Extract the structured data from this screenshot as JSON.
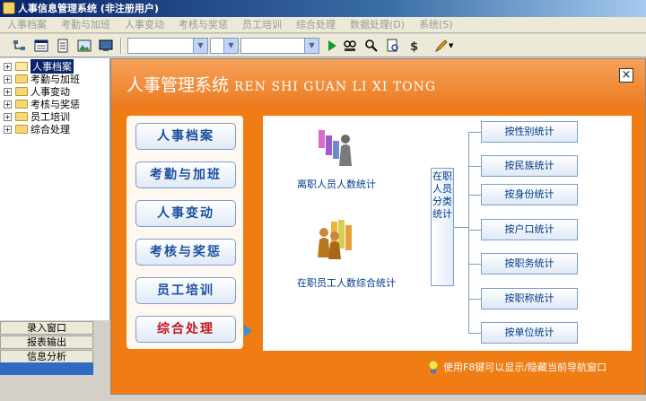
{
  "window": {
    "title": "人事信息管理系统 (非注册用户)"
  },
  "menu": [
    "人事档案",
    "考勤与加班",
    "人事变动",
    "考核与奖惩",
    "员工培训",
    "综合处理",
    "数据处理(D)",
    "系统(S)"
  ],
  "toolbar": {
    "icons": [
      "tree-view-icon",
      "form-icon",
      "document-icon",
      "picture-icon",
      "monitor-icon",
      "run-icon",
      "find-icon",
      "find-next-icon",
      "preview-icon",
      "dollar-icon",
      "pencil-icon"
    ]
  },
  "tree": {
    "items": [
      {
        "label": "人事档案",
        "expander": "+",
        "selected": true,
        "open": true
      },
      {
        "label": "考勤与加班",
        "expander": "+",
        "selected": false
      },
      {
        "label": "人事变动",
        "expander": "+",
        "selected": false
      },
      {
        "label": "考核与奖惩",
        "expander": "+",
        "selected": false
      },
      {
        "label": "员工培训",
        "expander": "+",
        "selected": false
      },
      {
        "label": "综合处理",
        "expander": "+",
        "selected": false
      }
    ]
  },
  "leftnav": {
    "items": [
      "录入窗口",
      "报表输出",
      "信息分析"
    ]
  },
  "main": {
    "title": "人事管理系统",
    "subtitle": "REN SHI GUAN LI XI TONG",
    "close": "×",
    "modules": [
      "人事档案",
      "考勤与加班",
      "人事变动",
      "考核与奖惩",
      "员工培训",
      "综合处理"
    ],
    "active_module": "综合处理",
    "stats": {
      "resigned": "离职人员人数统计",
      "employed": "在职员工人数综合统计",
      "category_box": "在职人员分类统计",
      "buttons": [
        "按性别统计",
        "按民族统计",
        "按身份统计",
        "按户口统计",
        "按职务统计",
        "按职称统计",
        "按单位统计"
      ]
    },
    "hint": "使用F8键可以显示/隐藏当前导航窗口"
  },
  "colors": {
    "accent": "#f07c14",
    "titlebar": "#0a246a",
    "button_text": "#1a4fa0",
    "active_text": "#c8161d"
  }
}
